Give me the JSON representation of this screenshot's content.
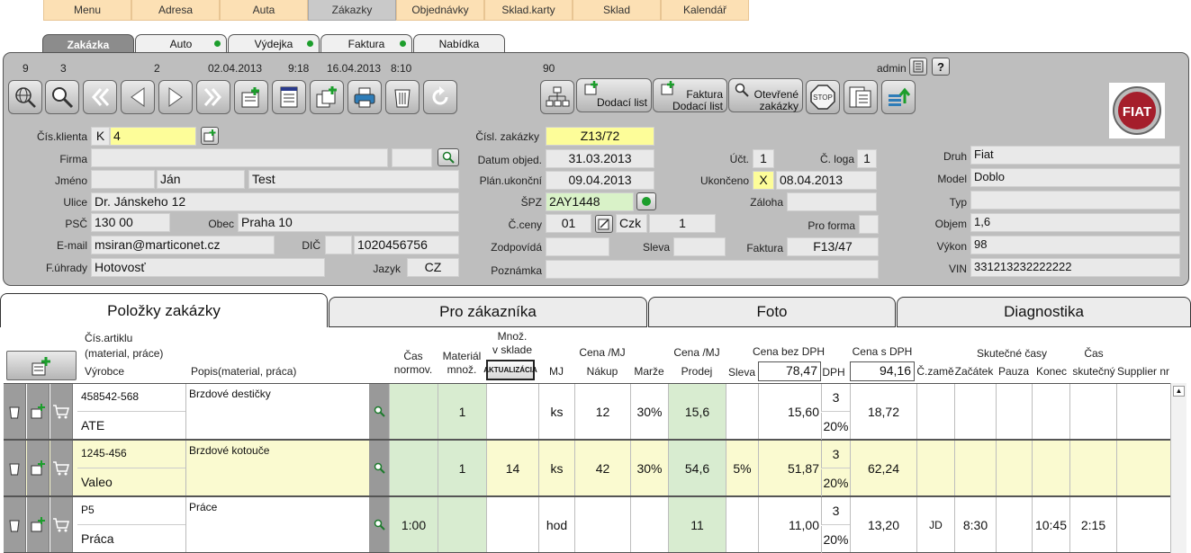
{
  "topmenu": [
    "Menu",
    "Adresa",
    "Auta",
    "Zákazky",
    "Objednávky",
    "Sklad.karty",
    "Sklad",
    "Kalendář"
  ],
  "tabs": [
    "Zakázka",
    "Auto",
    "Výdejka",
    "Faktura",
    "Nabídka"
  ],
  "toolbar_numbers": {
    "n1": "9",
    "n2": "3",
    "n3": "2",
    "date1": "02.04.2013",
    "time1": "9:18",
    "date2": "16.04.2013",
    "time2": "8:10",
    "n4": "90",
    "user": "admin"
  },
  "toolbar_buttons": {
    "dodaci_list": "Dodací list",
    "faktura_dodaci_1": "Faktura",
    "faktura_dodaci_2": "Dodací list",
    "otevrene_1": "Otevřené",
    "otevrene_2": "zakázky",
    "stop": "STOP",
    "help": "?",
    "logo": "FIAT"
  },
  "customer": {
    "cis_klienta_label": "Čís.klienta",
    "cis_klienta_prefix": "K",
    "cis_klienta": "4",
    "firma_label": "Firma",
    "firma": "",
    "jmeno_label": "Jméno",
    "jmeno_title": "",
    "jmeno": "Ján",
    "prijmeni": "Test",
    "ulice_label": "Ulice",
    "ulice": "Dr. Jánskeho 12",
    "psc_label": "PSČ",
    "psc": "130 00",
    "obec_label": "Obec",
    "obec": "Praha 10",
    "email_label": "E-mail",
    "email": "msiran@marticonet.cz",
    "dic_label": "DIČ",
    "dic": "1020456756",
    "fuhrady_label": "F.úhrady",
    "fuhrady": "Hotovosť",
    "jazyk_label": "Jazyk",
    "jazyk": "CZ"
  },
  "order": {
    "cisl_label": "Čísl. zakázky",
    "cisl": "Z13/72",
    "datum_label": "Datum objed.",
    "datum": "31.03.2013",
    "plan_label": "Plán.ukonční",
    "plan": "09.04.2013",
    "spz_label": "ŠPZ",
    "spz": "2AY1448",
    "ceny_label": "Č.ceny",
    "ceny": "01",
    "mena": "Czk",
    "kurz": "1",
    "zodp_label": "Zodpovídá",
    "sleva_label": "Sleva",
    "poznamka_label": "Poznámka",
    "uct_label": "Účt.",
    "uct": "1",
    "loga_label": "Č. loga",
    "loga": "1",
    "ukonceno_label": "Ukončeno",
    "ukonceno_x": "X",
    "ukonceno": "08.04.2013",
    "zaloha_label": "Záloha",
    "proforma_label": "Pro forma",
    "faktura_label": "Faktura",
    "faktura": "F13/47"
  },
  "vehicle": {
    "druh_label": "Druh",
    "druh": "Fiat",
    "model_label": "Model",
    "model": "Doblo",
    "typ_label": "Typ",
    "typ": "",
    "objem_label": "Objem",
    "objem": "1,6",
    "vykon_label": "Výkon",
    "vykon": "98",
    "vin_label": "VIN",
    "vin": "331213232222222"
  },
  "bottom_tabs": [
    "Položky zakázky",
    "Pro zákazníka",
    "Foto",
    "Diagnostika"
  ],
  "grid_headers": {
    "cis_artiklu": "Čís.artiklu",
    "material_prace": "(material, práce)",
    "vyrobce": "Výrobce",
    "popis": "Popis(material, práca)",
    "cas1": "Čas",
    "cas2": "normov.",
    "mat1": "Materiál",
    "mat2": "množ.",
    "mnoz1": "Množ.",
    "mnoz2": "v sklade",
    "aktualizacia": "AKTUALIZÁCIA",
    "mj": "MJ",
    "cena_nakup1": "Cena /MJ",
    "cena_nakup2": "Nákup",
    "marze": "Marže",
    "cena_prodej1": "Cena /MJ",
    "cena_prodej2": "Prodej",
    "sleva": "Sleva",
    "bez_dph": "Cena bez DPH",
    "bez_dph_total": "78,47",
    "dph": "DPH",
    "s_dph": "Cena s DPH",
    "s_dph_total": "94,16",
    "czame": "Č.zamě",
    "zacatek": "Začátek",
    "pauza": "Pauza",
    "konec": "Konec",
    "skutecne_casy": "Skutečné časy",
    "cas_sk1": "Čas",
    "cas_sk2": "skutečný",
    "supplier": "Supplier nr"
  },
  "rows": [
    {
      "artikl": "458542-568",
      "vyrobce": "ATE",
      "popis": "Brzdové destičky",
      "cas": "",
      "mnoz": "1",
      "sklad": "",
      "mj": "ks",
      "nakup": "12",
      "marze": "30%",
      "prodej": "15,6",
      "sleva": "",
      "bez_dph": "15,60",
      "dph_kod": "3",
      "dph": "20%",
      "s_dph": "18,72",
      "zam": "",
      "zacatek": "",
      "pauza": "",
      "konec": "",
      "skutecny": "",
      "supplier": ""
    },
    {
      "artikl": "1245-456",
      "vyrobce": "Valeo",
      "popis": "Brzdové kotouče",
      "cas": "",
      "mnoz": "1",
      "sklad": "14",
      "mj": "ks",
      "nakup": "42",
      "marze": "30%",
      "prodej": "54,6",
      "sleva": "5%",
      "bez_dph": "51,87",
      "dph_kod": "3",
      "dph": "20%",
      "s_dph": "62,24",
      "zam": "",
      "zacatek": "",
      "pauza": "",
      "konec": "",
      "skutecny": "",
      "supplier": ""
    },
    {
      "artikl": "P5",
      "vyrobce": "Práca",
      "popis": "Práce",
      "cas": "1:00",
      "mnoz": "",
      "sklad": "",
      "mj": "hod",
      "nakup": "",
      "marze": "",
      "prodej": "11",
      "sleva": "",
      "bez_dph": "11,00",
      "dph_kod": "3",
      "dph": "20%",
      "s_dph": "13,20",
      "zam": "JD",
      "zacatek": "8:30",
      "pauza": "",
      "konec": "10:45",
      "skutecny": "2:15",
      "supplier": ""
    }
  ],
  "colors": {
    "menu": "#fce0b4",
    "panel": "#bebebe",
    "yellow": "#fdfd99",
    "green": "#d8ecd0",
    "highlight_row": "#fafad0"
  }
}
